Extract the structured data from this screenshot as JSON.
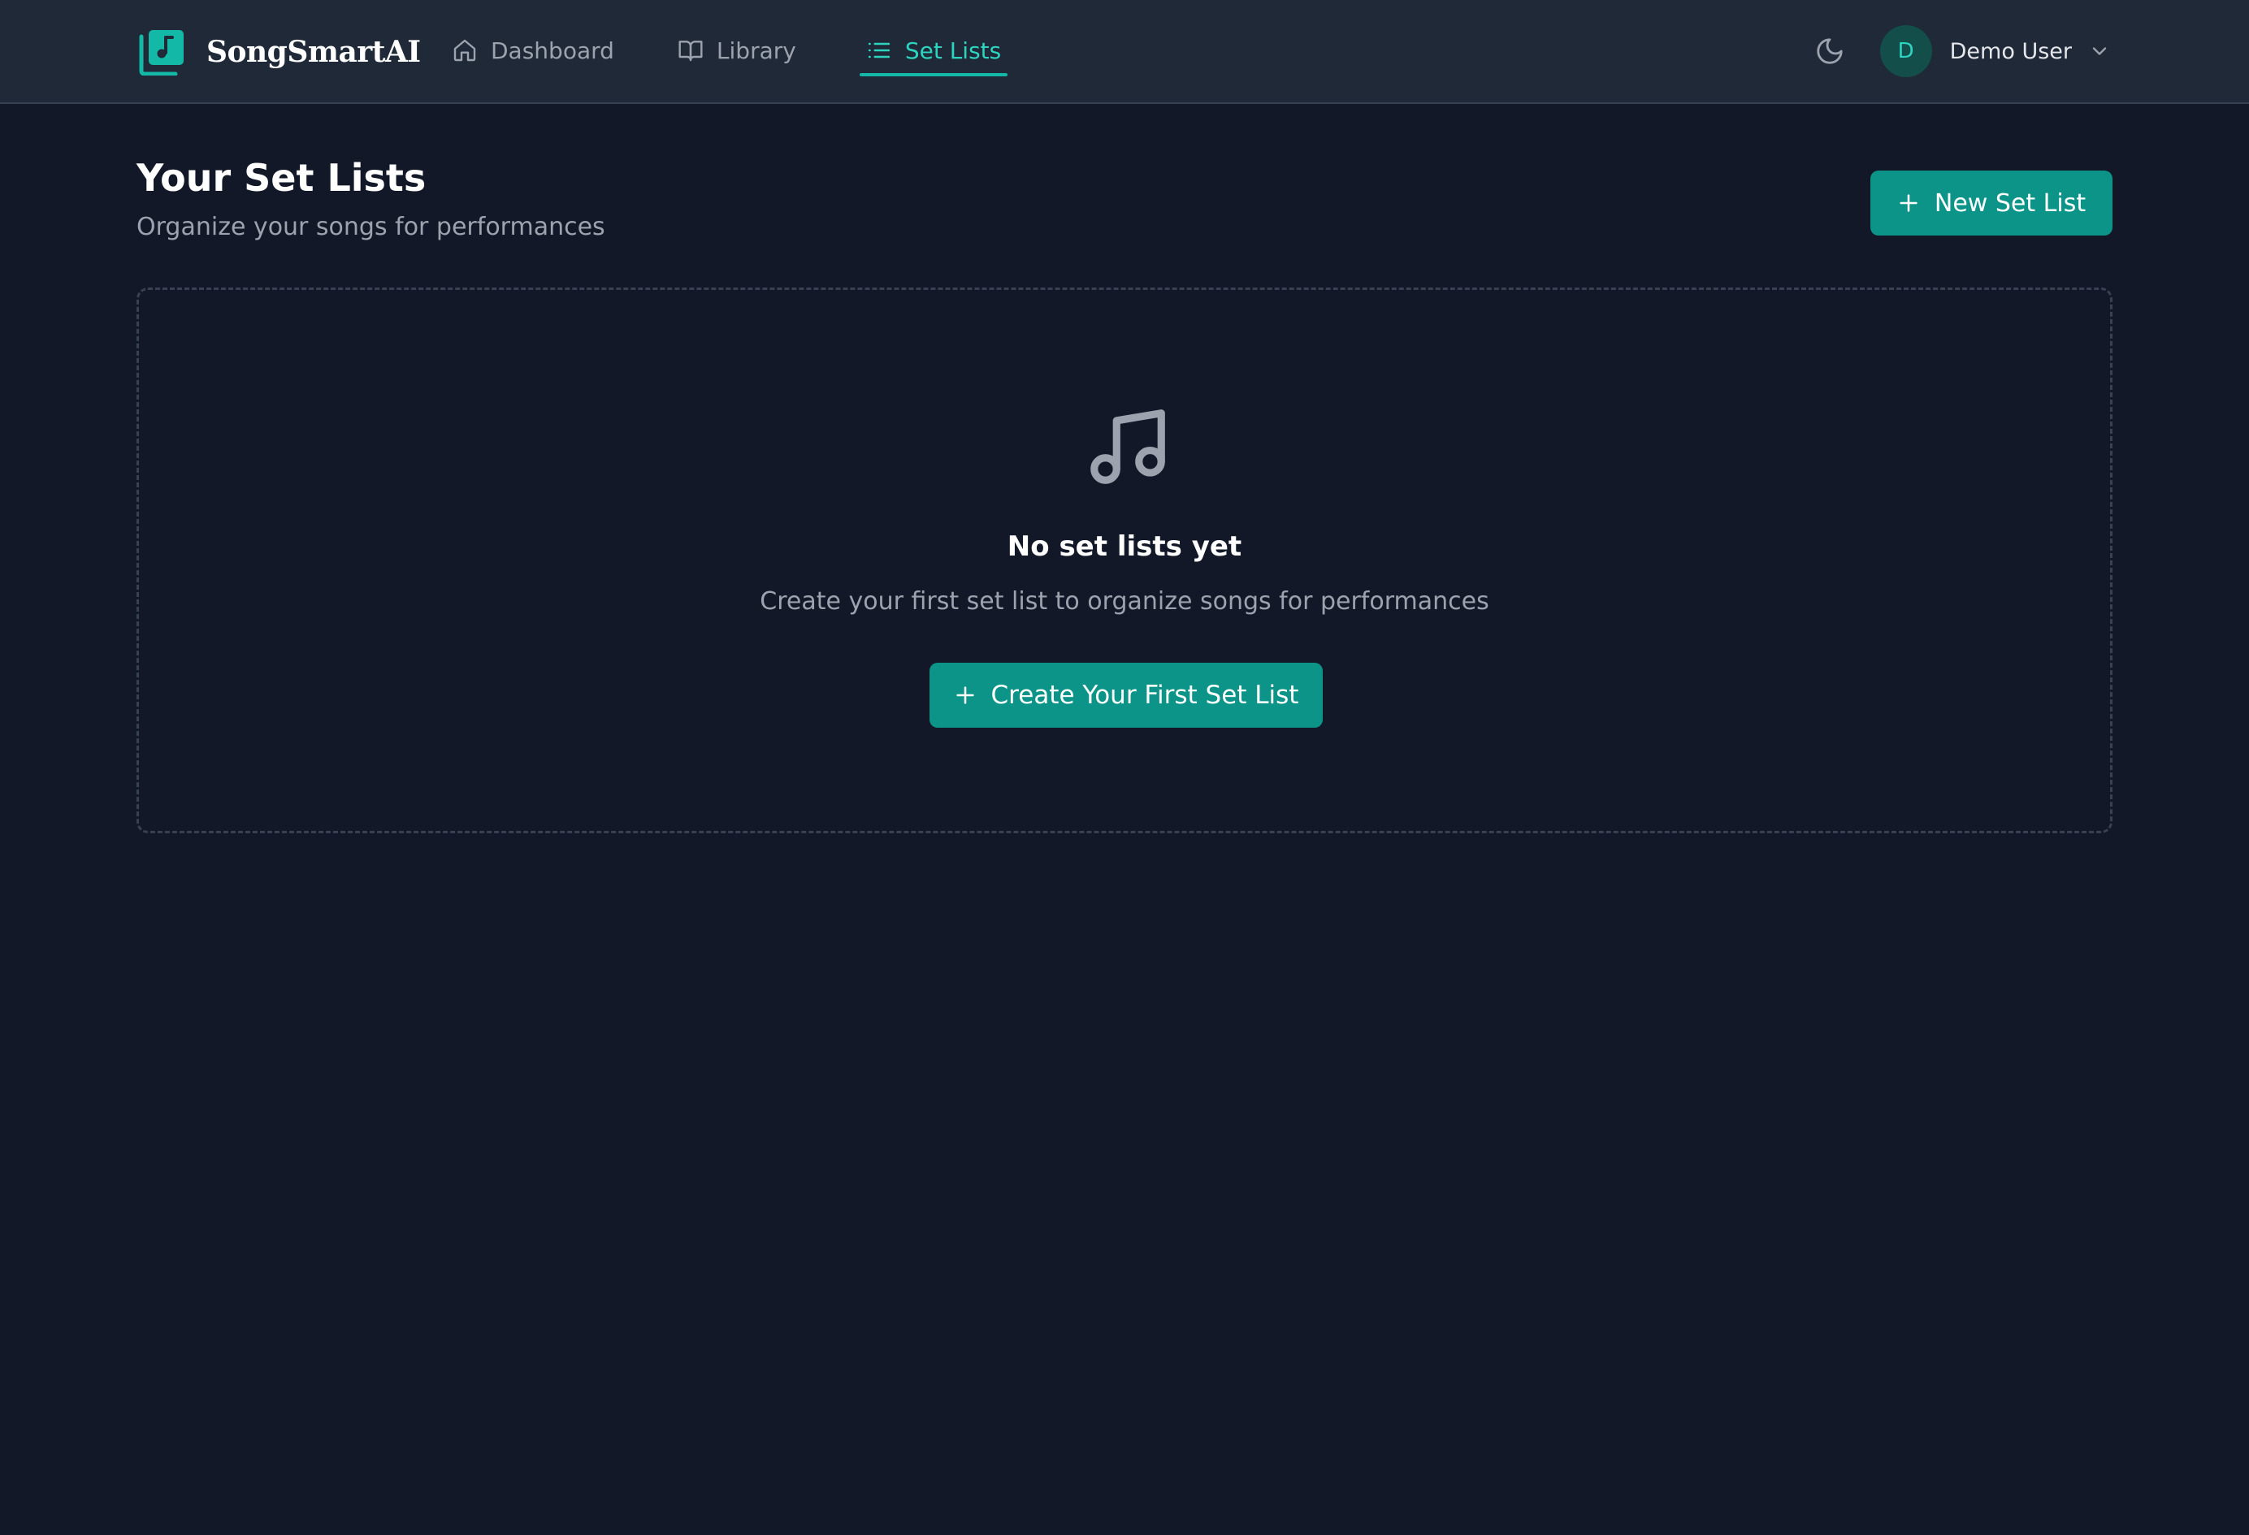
{
  "header": {
    "brand": {
      "name": "SongSmartAI",
      "logo_icon": "music-library-icon"
    },
    "nav": [
      {
        "label": "Dashboard",
        "icon": "home-icon",
        "active": false
      },
      {
        "label": "Library",
        "icon": "book-open-icon",
        "active": false
      },
      {
        "label": "Set Lists",
        "icon": "list-icon",
        "active": true
      }
    ],
    "theme_toggle_icon": "moon-icon",
    "user": {
      "initial": "D",
      "name": "Demo User",
      "menu_icon": "chevron-down-icon"
    }
  },
  "page": {
    "title": "Your Set Lists",
    "subtitle": "Organize your songs for performances",
    "new_button_label": "New Set List"
  },
  "empty_state": {
    "icon": "music-note-icon",
    "title": "No set lists yet",
    "description": "Create your first set list to organize songs for performances",
    "button_label": "Create Your First Set List"
  },
  "colors": {
    "background": "#121827",
    "header_background": "#1f2937",
    "accent": "#0d9488",
    "accent_text": "#2dd4bf",
    "muted_text": "#9ca3af"
  }
}
